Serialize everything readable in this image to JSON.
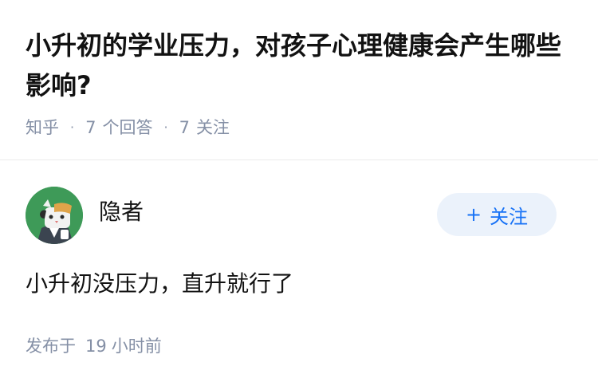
{
  "question": {
    "title": "小升初的学业压力，对孩子心理健康会产生哪些影响?",
    "source": "知乎",
    "separator": "·",
    "answer_count": "7",
    "answer_label": "个回答",
    "follow_count": "7",
    "follow_label": "关注"
  },
  "answer": {
    "author_name": "隐者",
    "avatar_icon": "cat-avatar-icon",
    "follow_button": {
      "plus": "+",
      "label": "关注"
    },
    "content": "小升初没压力，直升就行了",
    "time_prefix": "发布于",
    "time_value": "19",
    "time_unit": "小时前"
  },
  "colors": {
    "meta_gray": "#8590a6",
    "accent_blue": "#1772f6",
    "follow_bg": "#ebf2fb",
    "avatar_bg": "#3e9a58"
  }
}
